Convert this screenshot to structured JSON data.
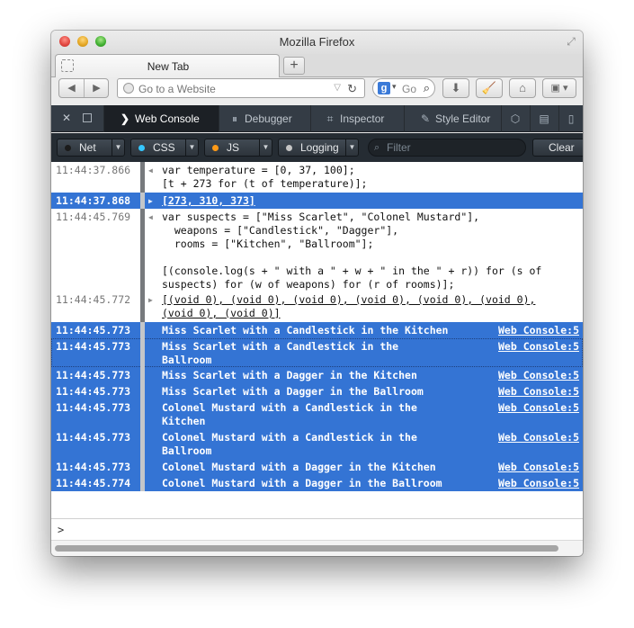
{
  "window": {
    "title": "Mozilla Firefox"
  },
  "tabs": [
    {
      "label": "New Tab"
    }
  ],
  "navbar": {
    "url_placeholder": "Go to a Website",
    "search_text": "Go",
    "search_engine_letter": "g"
  },
  "devtools": {
    "tabs": [
      {
        "label": "Web Console",
        "icon": "chevron-right-icon",
        "active": true
      },
      {
        "label": "Debugger",
        "icon": "pause-icon"
      },
      {
        "label": "Inspector",
        "icon": "inspector-icon"
      },
      {
        "label": "Style Editor",
        "icon": "pencil-icon"
      }
    ]
  },
  "filters": {
    "buttons": [
      {
        "label": "Net",
        "dot_color": "#1b1b1b"
      },
      {
        "label": "CSS",
        "dot_color": "#35c7ff"
      },
      {
        "label": "JS",
        "dot_color": "#ff9a17"
      },
      {
        "label": "Logging",
        "dot_color": "#c5c5c5"
      }
    ],
    "filter_placeholder": "Filter",
    "clear_label": "Clear"
  },
  "console": {
    "rows": [
      {
        "time": "11:44:37.866",
        "type": "input",
        "selected": false,
        "text": "var temperature = [0, 37, 100];\n[t + 273 for (t of temperature)];"
      },
      {
        "time": "11:44:37.868",
        "type": "result",
        "selected": true,
        "text": "[273, 310, 373]"
      },
      {
        "time": "11:44:45.769",
        "type": "input",
        "selected": false,
        "text": "var suspects = [\"Miss Scarlet\", \"Colonel Mustard\"],\n  weapons = [\"Candlestick\", \"Dagger\"],\n  rooms = [\"Kitchen\", \"Ballroom\"];\n\n[(console.log(s + \" with a \" + w + \" in the \" + r)) for (s of\nsuspects) for (w of weapons) for (r of rooms)];"
      },
      {
        "time": "11:44:45.772",
        "type": "result",
        "selected": false,
        "text": "[(void 0), (void 0), (void 0), (void 0), (void 0), (void 0),\n(void 0), (void 0)]"
      },
      {
        "time": "11:44:45.773",
        "type": "log",
        "selected": true,
        "text": "Miss Scarlet with a Candlestick in the Kitchen",
        "location": "Web Console:5"
      },
      {
        "time": "11:44:45.773",
        "type": "log",
        "selected": true,
        "focused": true,
        "text": "Miss Scarlet with a Candlestick in the\nBallroom",
        "location": "Web Console:5"
      },
      {
        "time": "11:44:45.773",
        "type": "log",
        "selected": true,
        "text": "Miss Scarlet with a Dagger in the Kitchen",
        "location": "Web Console:5"
      },
      {
        "time": "11:44:45.773",
        "type": "log",
        "selected": true,
        "text": "Miss Scarlet with a Dagger in the Ballroom",
        "location": "Web Console:5"
      },
      {
        "time": "11:44:45.773",
        "type": "log",
        "selected": true,
        "text": "Colonel Mustard with a Candlestick in the\nKitchen",
        "location": "Web Console:5"
      },
      {
        "time": "11:44:45.773",
        "type": "log",
        "selected": true,
        "text": "Colonel Mustard with a Candlestick in the\nBallroom",
        "location": "Web Console:5"
      },
      {
        "time": "11:44:45.773",
        "type": "log",
        "selected": true,
        "text": "Colonel Mustard with a Dagger in the Kitchen",
        "location": "Web Console:5"
      },
      {
        "time": "11:44:45.774",
        "type": "log",
        "selected": true,
        "text": "Colonel Mustard with a Dagger in the Ballroom",
        "location": "Web Console:5"
      }
    ],
    "prompt": ">"
  }
}
